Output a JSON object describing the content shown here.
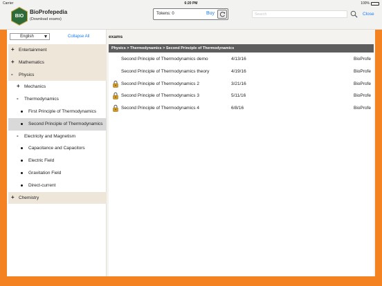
{
  "status_bar": {
    "carrier": "Carrier",
    "time": "6:20 PM",
    "battery": "100%"
  },
  "header": {
    "app_name": "BioProfepedia",
    "app_subtitle": "(Download exams)",
    "logo_text": "BIO",
    "tokens_label": "Tokens: 0",
    "buy_label": "Buy",
    "search_placeholder": "Search",
    "close_label": "Close"
  },
  "sidebar": {
    "language": "English",
    "collapse_label": "Collapse All",
    "tree": [
      {
        "label": "Entertainment",
        "sign": "+",
        "level": 0,
        "style": "beige"
      },
      {
        "label": "Mathematics",
        "sign": "+",
        "level": 0,
        "style": "beige"
      },
      {
        "label": "Physics",
        "sign": "-",
        "level": 0,
        "style": "beige"
      },
      {
        "label": "Mechanics",
        "sign": "+",
        "level": 1,
        "style": ""
      },
      {
        "label": "Thermodynamics",
        "sign": "-",
        "level": 1,
        "style": ""
      },
      {
        "label": "First Principle of Thermodynamics",
        "sign": "•",
        "level": 2,
        "style": ""
      },
      {
        "label": "Second Principle of Thermodynamics",
        "sign": "•",
        "level": 2,
        "style": "gray"
      },
      {
        "label": "Electricity and Magnetism",
        "sign": "-",
        "level": 1,
        "style": ""
      },
      {
        "label": "Capacitance and Capacitors",
        "sign": "•",
        "level": 2,
        "style": ""
      },
      {
        "label": "Electric Field",
        "sign": "•",
        "level": 2,
        "style": ""
      },
      {
        "label": "Gravitation Field",
        "sign": "•",
        "level": 2,
        "style": ""
      },
      {
        "label": "Direct-current",
        "sign": "•",
        "level": 2,
        "style": ""
      },
      {
        "label": "Chemistry",
        "sign": "+",
        "level": 0,
        "style": "beige"
      }
    ]
  },
  "content": {
    "title": "exams",
    "breadcrumb": "Physics > Thermodynamics > Second Principle of Thermodynamics",
    "exams": [
      {
        "name": "Second Principle of Thermodynamics demo",
        "date": "4/13/16",
        "author": "BioProfe",
        "locked": false
      },
      {
        "name": "Second Principle of Thermodynamics theory",
        "date": "4/19/16",
        "author": "BioProfe",
        "locked": false
      },
      {
        "name": "Second Principle of Thermodynamics 2",
        "date": "3/21/16",
        "author": "BioProfe",
        "locked": true
      },
      {
        "name": "Second Principle of Thermodynamics  3",
        "date": "5/11/16",
        "author": "BioProfe",
        "locked": true
      },
      {
        "name": "Second Principle of Thermodynamics 4",
        "date": "6/8/16",
        "author": "BioProfe",
        "locked": true
      }
    ]
  },
  "colors": {
    "accent_orange": "#f58220",
    "link_blue": "#1a7cf5",
    "logo_green": "#2f6b3a",
    "lock_gold": "#d29a22"
  }
}
